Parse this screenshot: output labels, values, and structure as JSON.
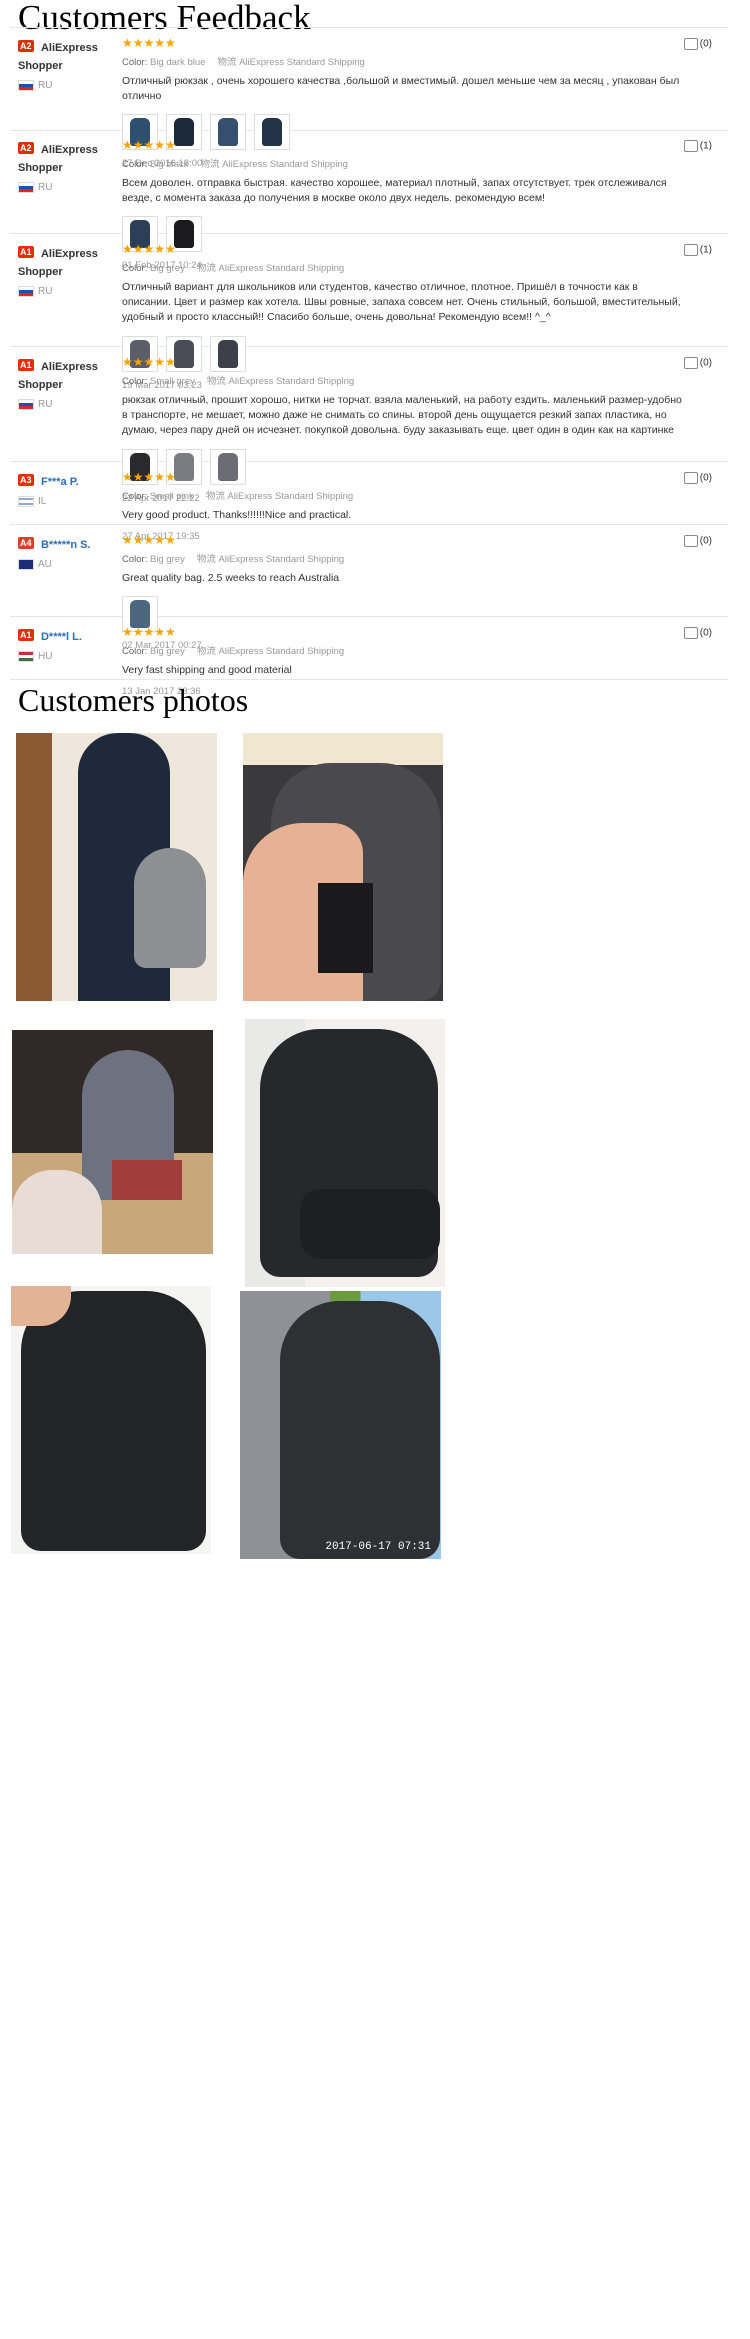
{
  "headings": {
    "feedback": "Customers Feedback",
    "photos": "Customers photos"
  },
  "labels": {
    "color_label": "Color:",
    "shipping_label": "物流"
  },
  "reviews": [
    {
      "level": "A2",
      "user_line1": "AliExpress",
      "user_line2": "Shopper",
      "country": "RU",
      "stars": "★★★★★",
      "color": "Big dark blue",
      "shipping": "AliExpress Standard Shipping",
      "text": "Отличный рюкзак , очень хорошего качества ,большой и вместимый. дошел меньше чем за месяц , упакован был отлично",
      "date": "27 Dec 2016 18:00",
      "helpful": "(0)"
    },
    {
      "level": "A2",
      "user_line1": "AliExpress",
      "user_line2": "Shopper",
      "country": "RU",
      "stars": "★★★★★",
      "color": "Big black",
      "shipping": "AliExpress Standard Shipping",
      "text": "Всем доволен. отправка быстрая. качество хорошее, материал плотный, запах отсутствует. трек отслеживался везде, с момента заказа до получения в москве около двух недель. рекомендую всем!",
      "date": "01 Feb 2017 10:24",
      "helpful": "(1)"
    },
    {
      "level": "A1",
      "user_line1": "AliExpress",
      "user_line2": "Shopper",
      "country": "RU",
      "stars": "★★★★★",
      "color": "Big grey",
      "shipping": "AliExpress Standard Shipping",
      "text": "Отличный вариант для школьников или студентов, качество отличное, плотное. Пришёл в точности как в описании. Цвет и размер как хотела. Швы ровные, запаха совсем нет. Очень стильный, большой, вместительный, удобный и просто классный!! Спасибо больше, очень довольна! Рекомендую всем!! ^_^",
      "date": "19 Mar 2017 03:23",
      "helpful": "(1)"
    },
    {
      "level": "A1",
      "user_line1": "AliExpress",
      "user_line2": "Shopper",
      "country": "RU",
      "stars": "★★★★★",
      "color": "Small grey",
      "shipping": "AliExpress Standard Shipping",
      "text": "рюкзак отличный, прошит хорошо, нитки не торчат. взяла маленький, на работу ездить. маленький размер-удобно в транспорте, не мешает, можно даже не снимать со спины. второй день ощущается резкий запах пластика, но думаю, через пару дней он исчезнет. покупкой довольна. буду заказывать еще. цвет один в один как на картинке",
      "date": "22 Apr 2017 22:22",
      "helpful": "(0)"
    },
    {
      "level": "A3",
      "user_line1": "F***a P.",
      "user_line2": "",
      "country": "IL",
      "stars": "★★★★★",
      "color": "Small pink",
      "shipping": "AliExpress Standard Shipping",
      "text": "Very good product. Thanks!!!!!!Nice and practical.",
      "date": "27 Apr 2017 19:35",
      "helpful": "(0)"
    },
    {
      "level": "A4",
      "user_line1": "B*****n S.",
      "user_line2": "",
      "country": "AU",
      "stars": "★★★★★",
      "color": "Big grey",
      "shipping": "AliExpress Standard Shipping",
      "text": "Great quality bag. 2.5 weeks to reach Australia",
      "date": "02 Mar 2017 00:27",
      "helpful": "(0)"
    },
    {
      "level": "A1",
      "user_line1": "D****l L.",
      "user_line2": "",
      "country": "HU",
      "stars": "★★★★★",
      "color": "Big grey",
      "shipping": "AliExpress Standard Shipping",
      "text": "Very fast shipping and good material",
      "date": "13 Jan 2017 23:36",
      "helpful": "(0)"
    }
  ],
  "photo_timestamp": "2017-06-17 07:31",
  "colors": {
    "star": "#f7a400",
    "level_badge": "#e62e04",
    "link_blue": "#2a6ebf"
  }
}
